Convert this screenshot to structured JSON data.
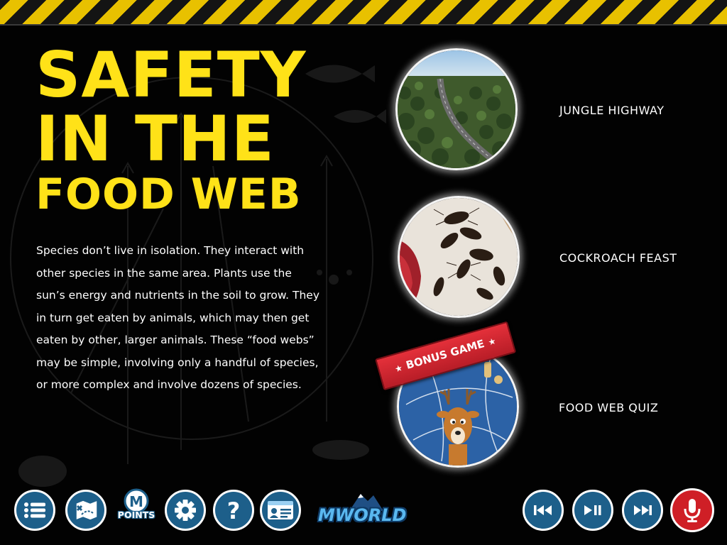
{
  "title": {
    "line1": "SAFETY",
    "line2": "IN THE",
    "line3": "FOOD WEB"
  },
  "intro": "Species don’t live in isolation.  They interact with other species in the same area.  Plants use the sun’s energy and nutrients in the soil to grow.  They in turn get eaten by animals, which may then get eaten by other, larger animals.  These “food webs” may be simple, involving only a handful of species, or more complex and involve dozens of species.",
  "episodes": [
    {
      "label": "JUNGLE HIGHWAY",
      "thumb_icon": "highway-forest-photo"
    },
    {
      "label": "COCKROACH FEAST",
      "thumb_icon": "cockroaches-photo"
    },
    {
      "label": "FOOD WEB QUIZ",
      "thumb_icon": "deer-quiz-illustration",
      "badge": "BONUS GAME"
    }
  ],
  "toolbar": {
    "left": [
      {
        "name": "menu-button",
        "icon": "list-icon"
      },
      {
        "name": "map-button",
        "icon": "map-icon"
      },
      {
        "name": "points-button",
        "icon": "points-badge",
        "label": "POINTS",
        "badge_letter": "M"
      },
      {
        "name": "settings-button",
        "icon": "gear-icon"
      },
      {
        "name": "help-button",
        "icon": "question-icon"
      },
      {
        "name": "id-card-button",
        "icon": "id-card-icon"
      }
    ],
    "logo": "MWORLD",
    "right": [
      {
        "name": "previous-button",
        "icon": "skip-back-icon"
      },
      {
        "name": "play-pause-button",
        "icon": "play-pause-icon"
      },
      {
        "name": "next-button",
        "icon": "skip-forward-icon"
      },
      {
        "name": "microphone-button",
        "icon": "microphone-icon"
      }
    ]
  },
  "colors": {
    "title_yellow": "#ffe218",
    "hazard_yellow": "#e8c100",
    "button_blue": "#1d5f8a",
    "mic_red": "#cf1f26",
    "background": "#020202"
  }
}
